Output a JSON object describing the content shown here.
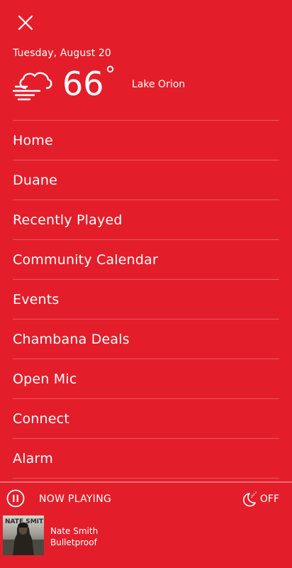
{
  "header": {
    "date": "Tuesday, August 20",
    "temperature": "66",
    "degree_symbol": "°",
    "city": "Lake Orion"
  },
  "menu": {
    "items": [
      {
        "label": "Home"
      },
      {
        "label": "Duane"
      },
      {
        "label": "Recently Played"
      },
      {
        "label": "Community Calendar"
      },
      {
        "label": "Events"
      },
      {
        "label": "Chambana Deals"
      },
      {
        "label": "Open Mic"
      },
      {
        "label": "Connect"
      },
      {
        "label": "Alarm"
      }
    ]
  },
  "player": {
    "status_label": "NOW PLAYING",
    "sleep_timer_label": "OFF",
    "artist": "Nate Smith",
    "track": "Bulletproof"
  },
  "colors": {
    "background": "#e31e2a",
    "text": "#ffffff"
  }
}
